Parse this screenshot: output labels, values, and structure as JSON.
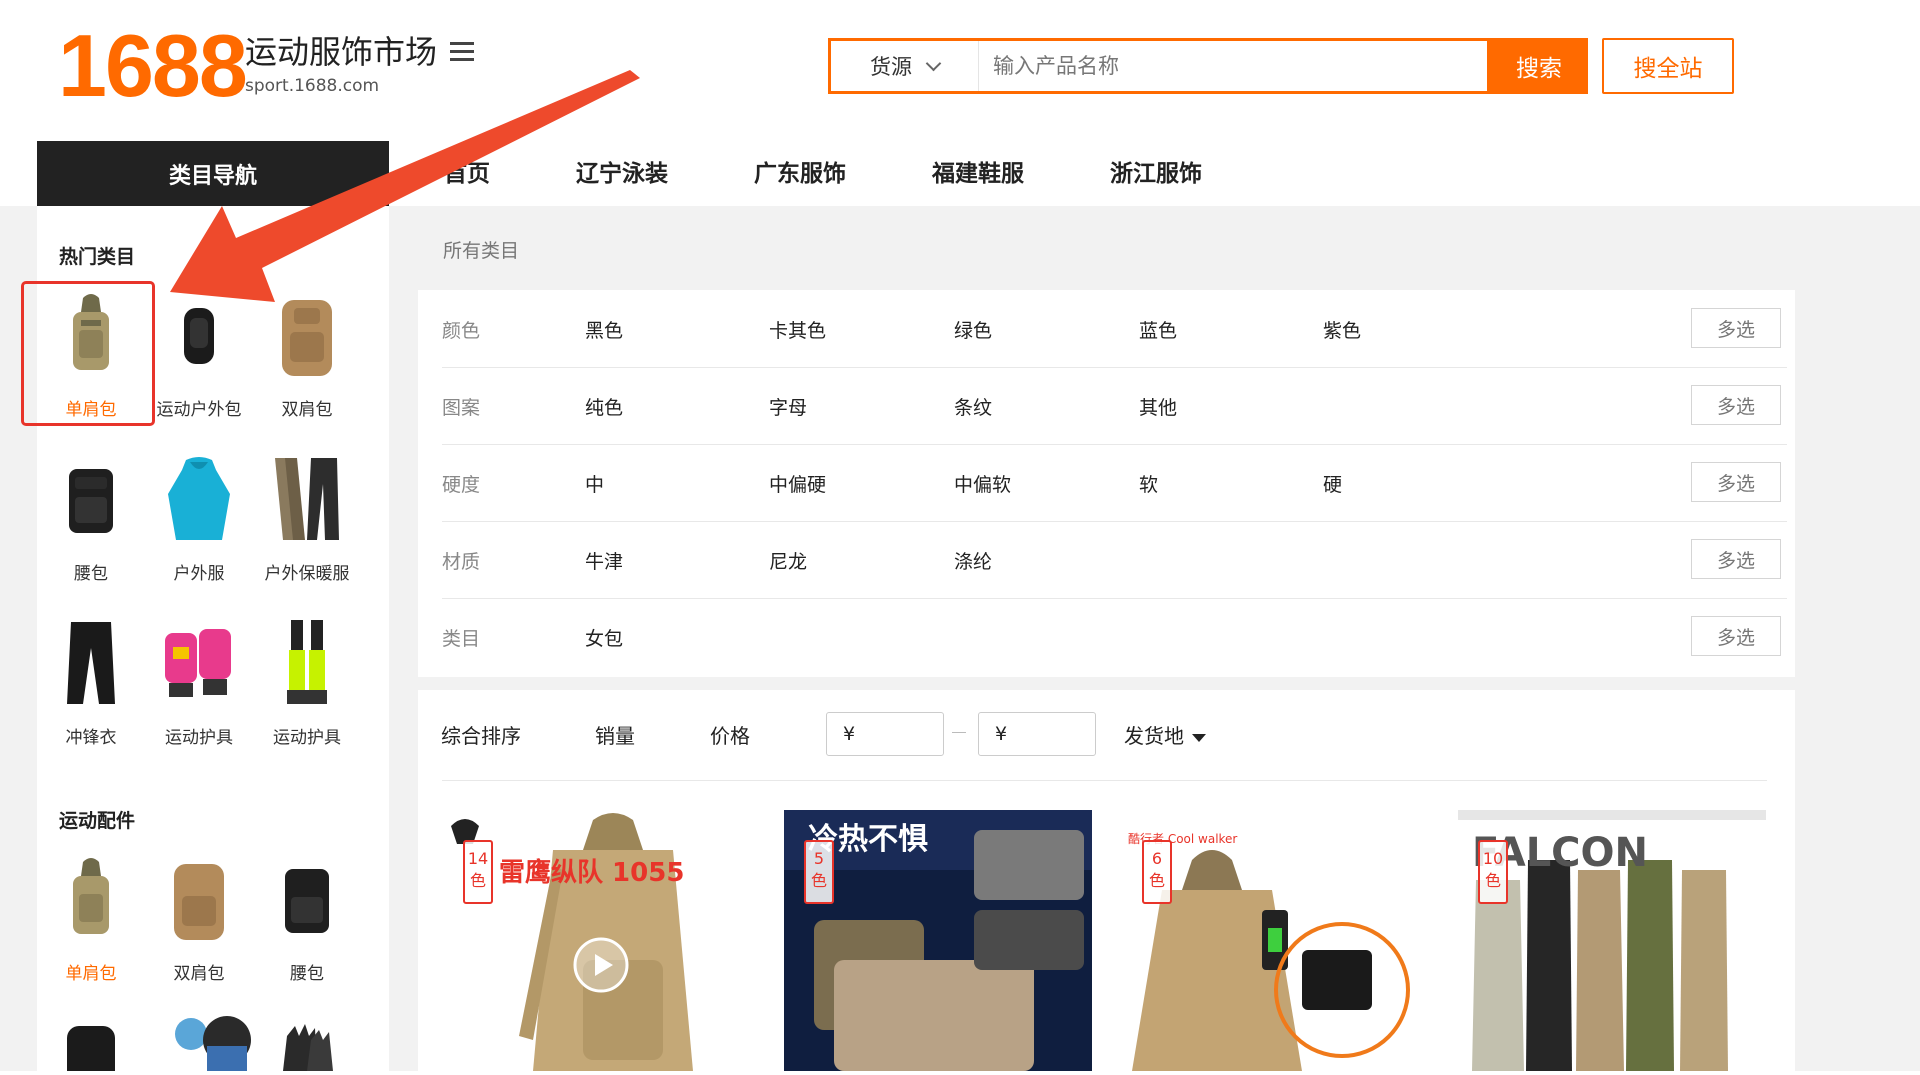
{
  "header": {
    "logo": "1688",
    "site_name": "运动服饰市场",
    "site_domain": "sport.1688.com",
    "search": {
      "source_label": "货源",
      "placeholder": "输入产品名称",
      "search_button": "搜索",
      "search_all_button": "搜全站"
    }
  },
  "nav": {
    "category_nav_label": "类目导航",
    "items": [
      "首页",
      "辽宁泳装",
      "广东服饰",
      "福建鞋服",
      "浙江服饰"
    ]
  },
  "sidebar": {
    "hot_title": "热门类目",
    "hot_items": [
      "单肩包",
      "运动户外包",
      "双肩包",
      "腰包",
      "户外服",
      "户外保暖服",
      "冲锋衣",
      "运动护具",
      "运动护具"
    ],
    "accessories_title": "运动配件",
    "accessory_items": [
      "单肩包",
      "双肩包",
      "腰包"
    ]
  },
  "filters": {
    "all_categories": "所有类目",
    "multi_select_label": "多选",
    "rows": [
      {
        "label": "颜色",
        "options": [
          "黑色",
          "卡其色",
          "绿色",
          "蓝色",
          "紫色"
        ]
      },
      {
        "label": "图案",
        "options": [
          "纯色",
          "字母",
          "条纹",
          "其他"
        ]
      },
      {
        "label": "硬度",
        "options": [
          "中",
          "中偏硬",
          "中偏软",
          "软",
          "硬"
        ]
      },
      {
        "label": "材质",
        "options": [
          "牛津",
          "尼龙",
          "涤纶"
        ]
      },
      {
        "label": "类目",
        "options": [
          "女包"
        ]
      }
    ]
  },
  "sort": {
    "comprehensive": "综合排序",
    "sales": "销量",
    "price": "价格",
    "price_min_prefix": "¥",
    "price_max_prefix": "¥",
    "ship_from": "发货地"
  },
  "products": [
    {
      "color_count": "14",
      "unit": "色",
      "image_text": "雷鹰纵队 1055"
    },
    {
      "color_count": "5",
      "unit": "色",
      "image_text": "冷热不惧"
    },
    {
      "color_count": "6",
      "unit": "色",
      "image_text": "酷行者 Cool walker"
    },
    {
      "color_count": "10",
      "unit": "色",
      "image_text": "FALCON"
    }
  ],
  "colors": {
    "accent": "#ff6a00",
    "highlight": "#e8342a",
    "nav_dark": "#222222"
  }
}
